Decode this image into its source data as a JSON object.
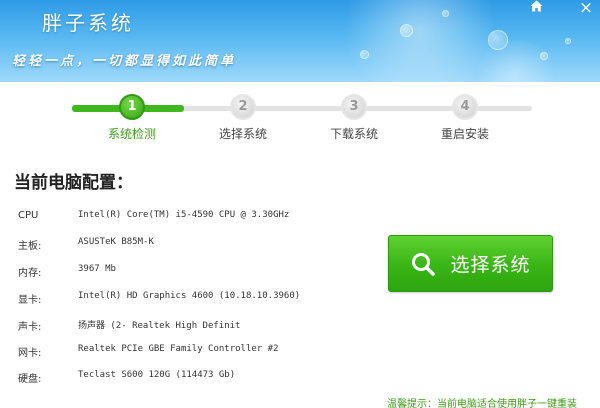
{
  "app": {
    "title": "胖子系统",
    "slogan": "轻轻一点，一切都显得如此简单"
  },
  "window": {
    "home_icon": "home-icon",
    "close_glyph": "×"
  },
  "steps": [
    {
      "num": "1",
      "label": "系统检测",
      "active": true
    },
    {
      "num": "2",
      "label": "选择系统",
      "active": false
    },
    {
      "num": "3",
      "label": "下载系统",
      "active": false
    },
    {
      "num": "4",
      "label": "重启安装",
      "active": false
    }
  ],
  "config": {
    "title": "当前电脑配置：",
    "rows": [
      {
        "key": "CPU",
        "value": "Intel(R) Core(TM) i5-4590 CPU @ 3.30GHz"
      },
      {
        "key": "主板:",
        "value": "ASUSTeK B85M-K"
      },
      {
        "key": "内存:",
        "value": "3967 Mb"
      },
      {
        "key": "显卡:",
        "value": "Intel(R) HD Graphics 4600 (10.18.10.3960)"
      },
      {
        "key": "声卡:",
        "value": "扬声器 (2- Realtek High Definit"
      },
      {
        "key": "网卡:",
        "value": "Realtek PCIe GBE Family Controller #2"
      },
      {
        "key": "硬盘:",
        "value": "Teclast S600 120G (114473 Gb)"
      }
    ]
  },
  "actions": {
    "select_system": "选择系统",
    "icon": "search-icon"
  },
  "tip": {
    "prefix": "温馨提示：",
    "text": "当前电脑适合使用胖子一键重装"
  },
  "colors": {
    "accent_green": "#39b515",
    "header_blue": "#2f9be6"
  }
}
